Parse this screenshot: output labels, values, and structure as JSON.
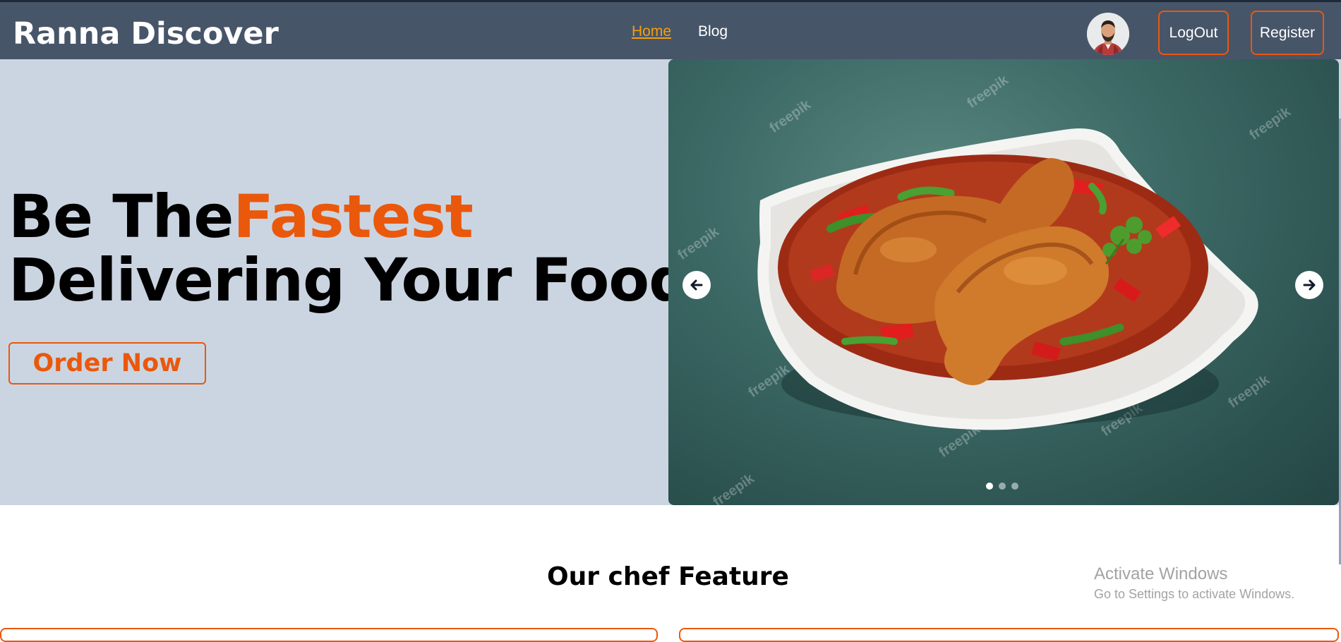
{
  "navbar": {
    "brand": "Ranna Discover",
    "links": [
      {
        "label": "Home",
        "active": true
      },
      {
        "label": "Blog",
        "active": false
      }
    ],
    "logout_label": "LogOut",
    "register_label": "Register",
    "avatar_icon": "user-avatar-icon",
    "bg_color": "#475569",
    "accent_color": "#ea580c",
    "active_link_color": "#f59e0b"
  },
  "hero": {
    "title_prefix": "Be The",
    "title_accent": "Fastest",
    "title_line2": "Delivering Your Food",
    "cta_label": "Order Now",
    "bg_color": "#cbd5e1"
  },
  "carousel": {
    "image_alt": "chicken curry in a white bowl",
    "watermark": "freepik",
    "prev_icon": "arrow-left-icon",
    "next_icon": "arrow-right-icon",
    "slide_count": 3,
    "active_slide": 1
  },
  "features": {
    "title": "Our chef Feature"
  },
  "os_overlay": {
    "line1": "Activate Windows",
    "line2": "Go to Settings to activate Windows."
  }
}
